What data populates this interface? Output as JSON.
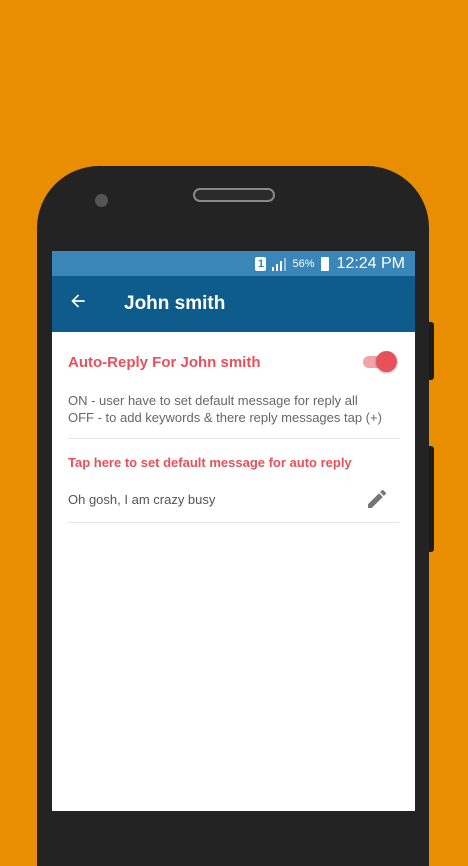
{
  "status_bar": {
    "sim_label": "1",
    "battery": "56%",
    "time": "12:24 PM"
  },
  "app_bar": {
    "back_icon": "arrow-left-icon",
    "title": "John smith"
  },
  "auto_reply": {
    "label": "Auto-Reply For John smith",
    "enabled": true,
    "toggle_color": "#E8505B",
    "description_line1": "ON - user have to set default message for reply all",
    "description_line2": "OFF - to add keywords & there reply messages tap (+)"
  },
  "default_message": {
    "tap_label": "Tap here to set default message for auto reply",
    "text": "Oh gosh, I am crazy busy",
    "edit_icon": "pencil-icon"
  },
  "colors": {
    "background": "#E88E00",
    "status_bar": "#3a86b8",
    "app_bar": "#0e5c8c",
    "accent": "#E8505B"
  }
}
